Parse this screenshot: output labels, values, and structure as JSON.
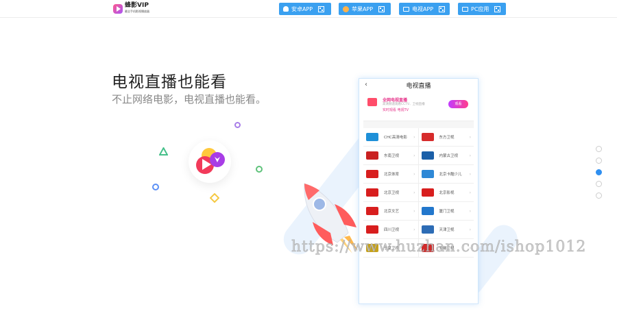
{
  "header": {
    "logo_name": "蜂影VIP",
    "logo_slogan": "最全手机影视播放器",
    "nav": [
      {
        "label": "安卓APP",
        "icon": "android-icon"
      },
      {
        "label": "苹果APP",
        "icon": "apple-icon"
      },
      {
        "label": "电视APP",
        "icon": "tv-icon"
      },
      {
        "label": "PC应用",
        "icon": "pc-icon"
      }
    ]
  },
  "hero": {
    "title": "电视直播也能看",
    "subtitle": "不止网络电影，电视直播也能看。"
  },
  "phone": {
    "title": "电视直播",
    "back": "‹",
    "promo": {
      "title": "全网电视直播",
      "desc": "高清频道观看CCTV、卫视直播",
      "tags": "实时观看   电视TV",
      "button": "观看"
    },
    "channels": [
      {
        "name": "CHC高清电影",
        "color": "#1e90d8"
      },
      {
        "name": "东方卫视",
        "color": "#d62b2b"
      },
      {
        "name": "东南卫视",
        "color": "#c92121"
      },
      {
        "name": "内蒙古卫视",
        "color": "#1b5fa8"
      },
      {
        "name": "北京体育",
        "color": "#d81e1e"
      },
      {
        "name": "北京卡酷少儿",
        "color": "#2e88d6"
      },
      {
        "name": "北京卫视",
        "color": "#d81e1e"
      },
      {
        "name": "北京影视",
        "color": "#d81e1e"
      },
      {
        "name": "北京文艺",
        "color": "#d81e1e"
      },
      {
        "name": "厦门卫视",
        "color": "#2277cc"
      },
      {
        "name": "四川卫视",
        "color": "#d81e1e"
      },
      {
        "name": "天津卫视",
        "color": "#2d6cb5"
      },
      {
        "name": "宁夏卫视",
        "color": "#c7a21a"
      },
      {
        "name": "安徽卫视",
        "color": "#d12a2a"
      }
    ]
  },
  "pager": {
    "count": 5,
    "active_index": 2
  },
  "watermark": "https://www.huzhan.com/ishop1012"
}
